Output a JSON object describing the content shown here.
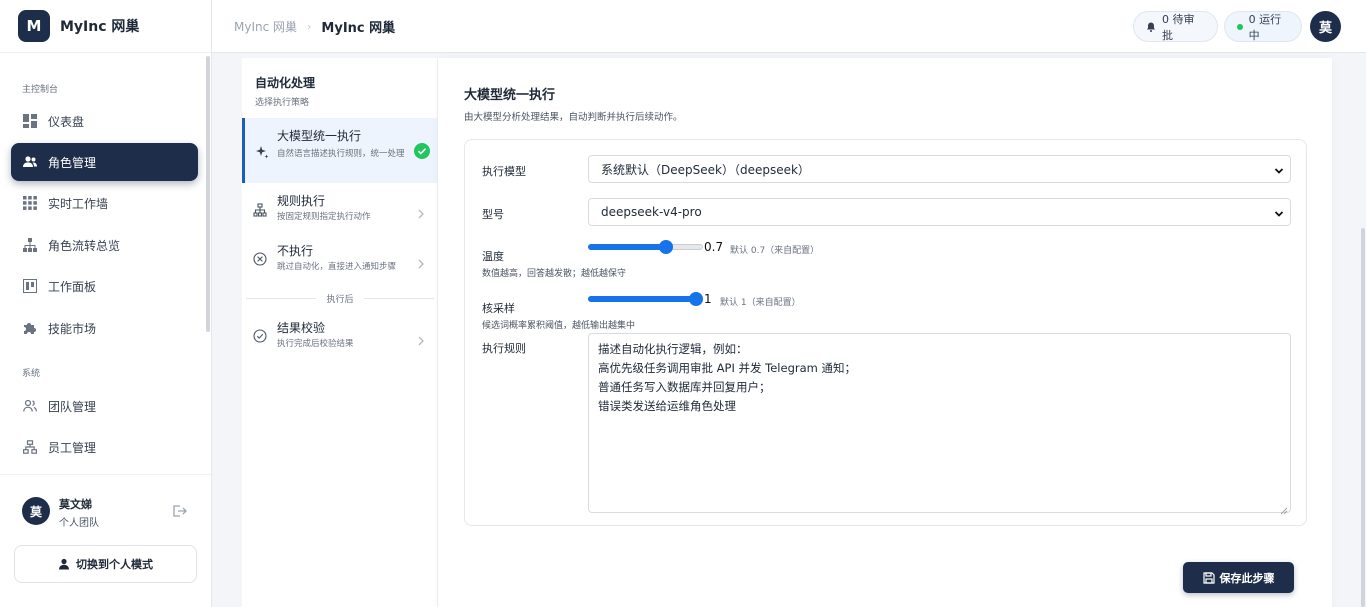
{
  "brand": {
    "logo_letter": "M",
    "name": "MyInc 网巢"
  },
  "sidebar": {
    "section_main": "主控制台",
    "section_system": "系统",
    "items": [
      {
        "label": "仪表盘",
        "icon": "dashboard-icon"
      },
      {
        "label": "角色管理",
        "icon": "users-icon",
        "active": true
      },
      {
        "label": "实时工作墙",
        "icon": "grid-icon"
      },
      {
        "label": "角色流转总览",
        "icon": "hierarchy-icon"
      },
      {
        "label": "工作面板",
        "icon": "kanban-icon"
      },
      {
        "label": "技能市场",
        "icon": "puzzle-icon"
      },
      {
        "label": "团队管理",
        "icon": "team-icon"
      },
      {
        "label": "员工管理",
        "icon": "org-icon"
      }
    ],
    "user": {
      "avatar": "莫",
      "name": "莫文娣",
      "team": "个人团队"
    },
    "switch_label": "切换到个人模式"
  },
  "header": {
    "breadcrumb": [
      "MyInc 网巢",
      "MyInc 网巢"
    ],
    "pending": "0 待审批",
    "running": "0 运行中",
    "avatar": "莫"
  },
  "strategy": {
    "title": "自动化处理",
    "subtitle": "选择执行策略",
    "options": [
      {
        "title": "大模型统一执行",
        "desc": "自然语言描述执行规则，统一处理",
        "icon": "sparkle-icon",
        "selected": true
      },
      {
        "title": "规则执行",
        "desc": "按固定规则指定执行动作",
        "icon": "flow-icon"
      },
      {
        "title": "不执行",
        "desc": "跳过自动化，直接进入通知步骤",
        "icon": "x-circle-icon"
      }
    ],
    "after_label": "执行后",
    "after_options": [
      {
        "title": "结果校验",
        "desc": "执行完成后校验结果",
        "icon": "check-circle-icon"
      }
    ]
  },
  "panel": {
    "title": "大模型统一执行",
    "subtitle": "由大模型分析处理结果，自动判断并执行后续动作。",
    "model_label": "执行模型",
    "model_value": "系统默认（DeepSeek）（deepseek）",
    "type_label": "型号",
    "type_value": "deepseek-v4-pro",
    "temperature": {
      "label": "温度",
      "help": "数值越高，回答越发散；越低越保守",
      "value": "0.7",
      "hint": "默认 0.7（来自配置）",
      "level": 0.7
    },
    "top_p": {
      "label": "核采样",
      "help": "候选词概率累积阈值，越低输出越集中",
      "value": "1",
      "hint": "默认 1（来自配置）",
      "level": 1.0
    },
    "rules_label": "执行规则",
    "rules_lines": [
      "描述自动化执行逻辑，例如：",
      "高优先级任务调用审批 API 并发 Telegram 通知；",
      "普通任务写入数据库并回复用户；",
      "错误类发送给运维角色处理"
    ]
  },
  "save_label": "保存此步骤"
}
